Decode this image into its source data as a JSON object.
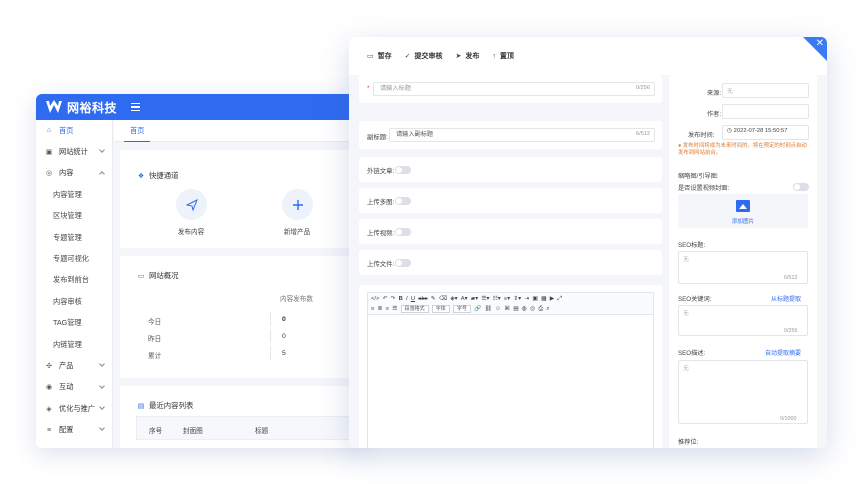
{
  "brand": {
    "name": "网裕科技"
  },
  "sidebar": {
    "items": [
      {
        "label": "首页",
        "icon": "home-icon"
      },
      {
        "label": "网站统计",
        "icon": "chart-icon"
      },
      {
        "label": "内容",
        "icon": "content-icon"
      },
      {
        "label": "内容管理"
      },
      {
        "label": "区块管理"
      },
      {
        "label": "专题管理"
      },
      {
        "label": "专题可视化"
      },
      {
        "label": "发布到前台"
      },
      {
        "label": "内容审核"
      },
      {
        "label": "TAG管理"
      },
      {
        "label": "内链管理"
      },
      {
        "label": "产品",
        "icon": "product-icon"
      },
      {
        "label": "互动",
        "icon": "interact-icon"
      },
      {
        "label": "优化与推广",
        "icon": "promote-icon"
      },
      {
        "label": "配置",
        "icon": "config-icon"
      }
    ]
  },
  "tabs": {
    "home": "首页"
  },
  "quick": {
    "title": "快捷通道",
    "publish": "发布内容",
    "add_product": "新增产品"
  },
  "overview": {
    "title": "网站概况",
    "column": "内容发布数",
    "rows": [
      {
        "label": "今日",
        "value": "0"
      },
      {
        "label": "昨日",
        "value": "0"
      },
      {
        "label": "累计",
        "value": "5"
      }
    ]
  },
  "recent": {
    "title": "最近内容列表",
    "columns": [
      "序号",
      "封面图",
      "标题"
    ]
  },
  "editor_toolbar": {
    "save": "暂存",
    "submit": "提交审核",
    "publish": "发布",
    "top": "置顶"
  },
  "form": {
    "title_placeholder": "请输入标题",
    "title_count": "0/256",
    "subtitle_label": "副标题:",
    "subtitle_placeholder": "请输入副标题",
    "subtitle_count": "6/512",
    "external_label": "外链文章:",
    "multi_upload_label": "上传多图:",
    "video_label": "上传视频:",
    "file_label": "上传文件:"
  },
  "rich_editor": {
    "paragraph_select": "段落格式",
    "font_select": "字体",
    "size_select": "字号"
  },
  "meta": {
    "source_label": "来源:",
    "source_placeholder": "无",
    "author_label": "作者:",
    "time_label": "发布时间:",
    "time_value": "2022-07-28 15:50:57",
    "note": "发布时间将成为未来时间的，将在预定的时刻点自动发布到网站前台。",
    "thumb_label": "缩略图/引导图:",
    "video_cover_label": "是否设置视频封面:",
    "add_image": "添加图片",
    "seo_title_label": "SEO标题:",
    "seo_title_placeholder": "无",
    "seo_title_count": "0/512",
    "seo_kw_label": "SEO关键词:",
    "seo_kw_link": "从标题提取",
    "seo_kw_placeholder": "无",
    "seo_kw_count": "0/256",
    "seo_desc_label": "SEO描述:",
    "seo_desc_link": "自动提取摘要",
    "seo_desc_placeholder": "无",
    "seo_desc_count": "0/1000",
    "recommend_label": "推荐位:"
  },
  "colors": {
    "accent": "#2f6bf0",
    "warning": "#e07a2e"
  }
}
